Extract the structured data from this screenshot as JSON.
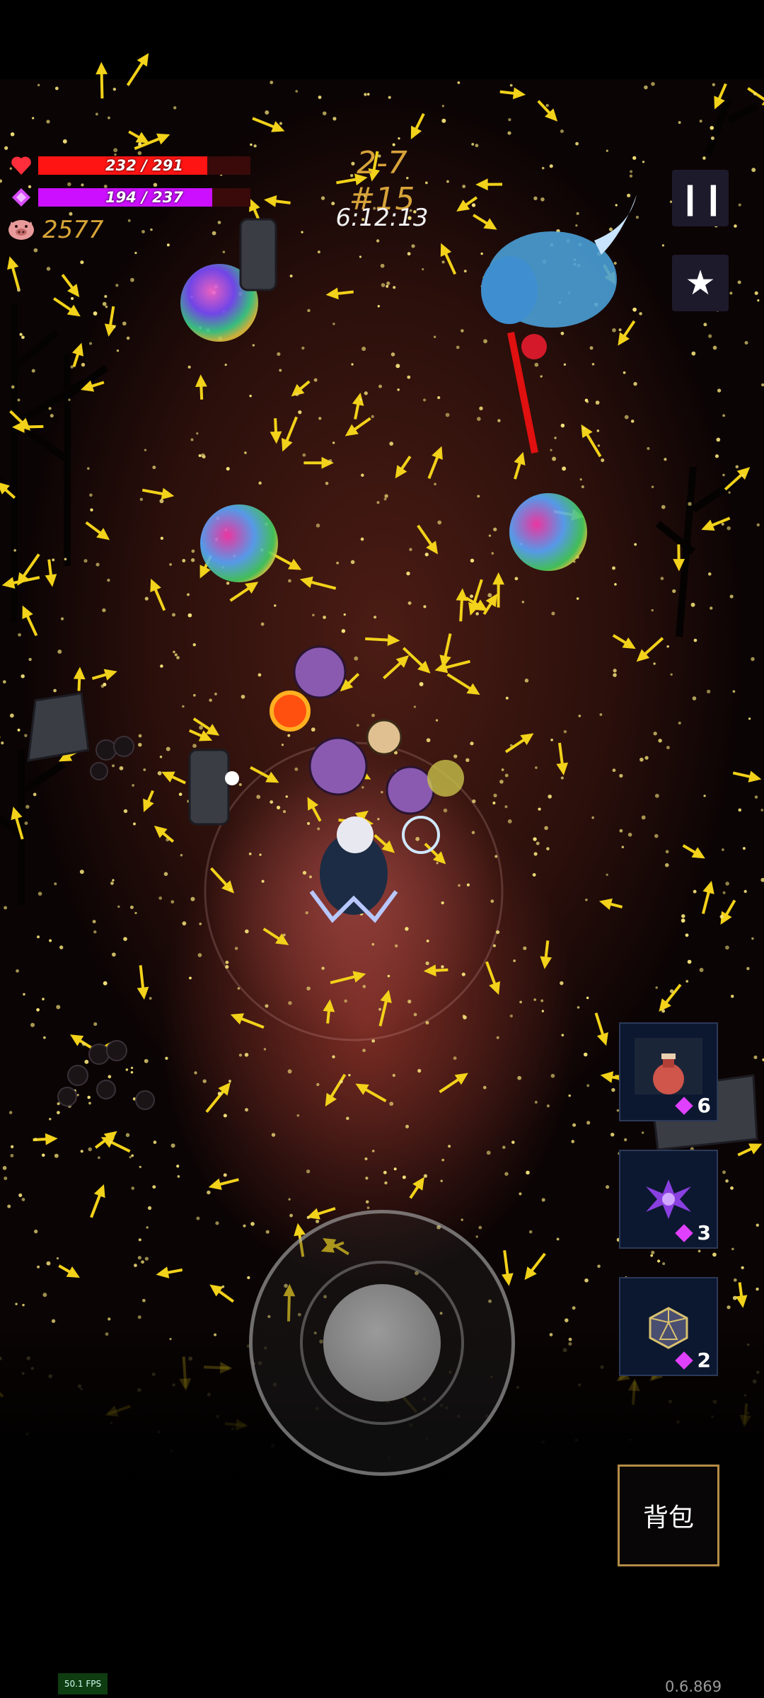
{
  "hud": {
    "health": {
      "icon": "heart-icon",
      "current": 232,
      "max": 291,
      "text": "232 / 291",
      "color": "#ff1414"
    },
    "mana": {
      "icon": "diamond-gem-icon",
      "current": 194,
      "max": 237,
      "text": "194 / 237",
      "color": "#cc10ff"
    },
    "coins": {
      "icon": "pig-icon",
      "value": "2577",
      "color": "#d8a638"
    },
    "stage": "2-7 #15",
    "timer": "6:12:13"
  },
  "controls": {
    "pause_icon": "pause-icon",
    "favorite_icon": "star-icon",
    "backpack_label": "背包"
  },
  "skills": [
    {
      "icon": "potion-icon",
      "cost": "6"
    },
    {
      "icon": "purple-shuriken-icon",
      "cost": "3"
    },
    {
      "icon": "d20-dice-icon",
      "cost": "2"
    }
  ],
  "debug": {
    "fps": "50.1 FPS",
    "version": "0.6.869"
  }
}
